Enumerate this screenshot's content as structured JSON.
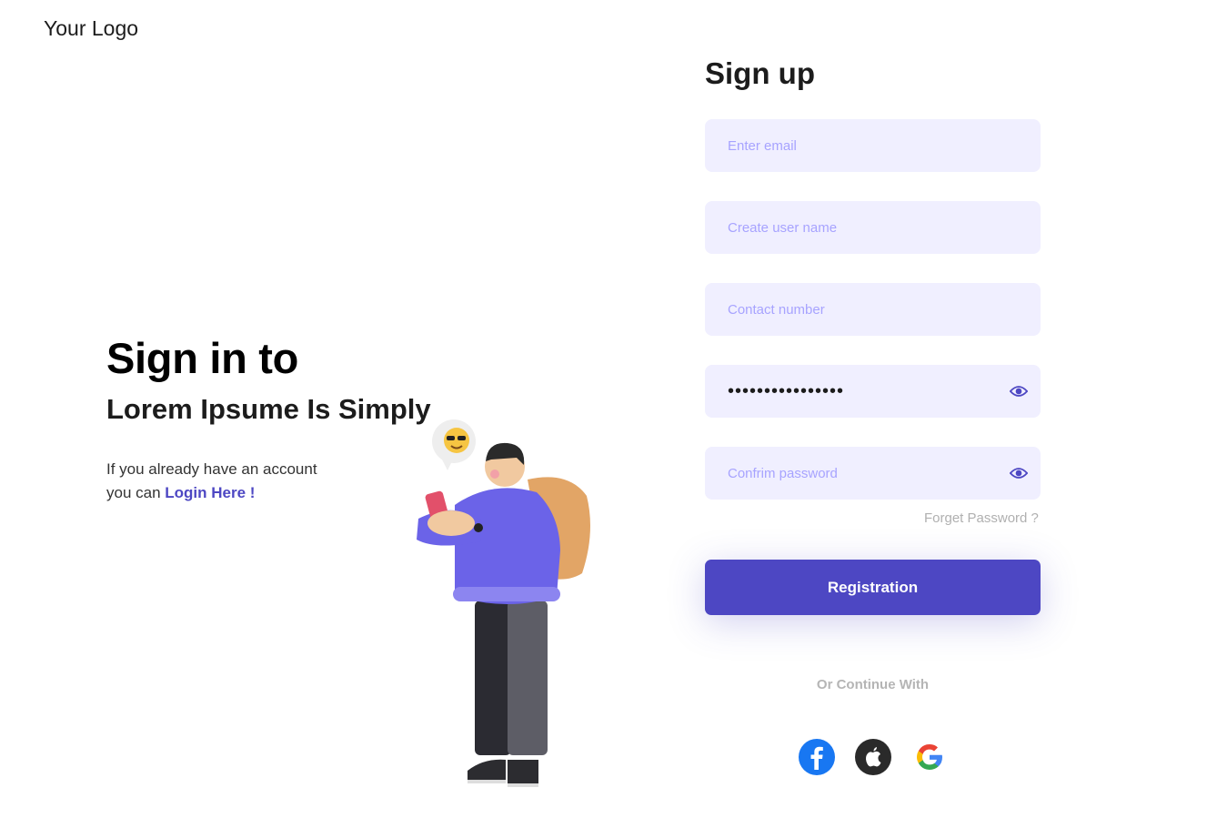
{
  "header": {
    "logo": "Your Logo"
  },
  "hero": {
    "title": "Sign in to",
    "subtitle": "Lorem Ipsume Is Simply",
    "text_line1": "If you already have an account",
    "text_line2_prefix": "you can ",
    "login_link": "Login Here !"
  },
  "form": {
    "title": "Sign up",
    "email_placeholder": "Enter email",
    "username_placeholder": "Create user name",
    "contact_placeholder": "Contact number",
    "password_value": "••••••••••••••••",
    "confirm_placeholder": "Confrim password",
    "forget_password": "Forget Password ?",
    "register_label": "Registration",
    "or_continue": "Or Continue With"
  },
  "social": [
    "facebook-icon",
    "apple-icon",
    "google-icon"
  ],
  "colors": {
    "accent": "#4d47c3",
    "field_bg": "#f0efff",
    "placeholder": "#a7a3ff"
  }
}
